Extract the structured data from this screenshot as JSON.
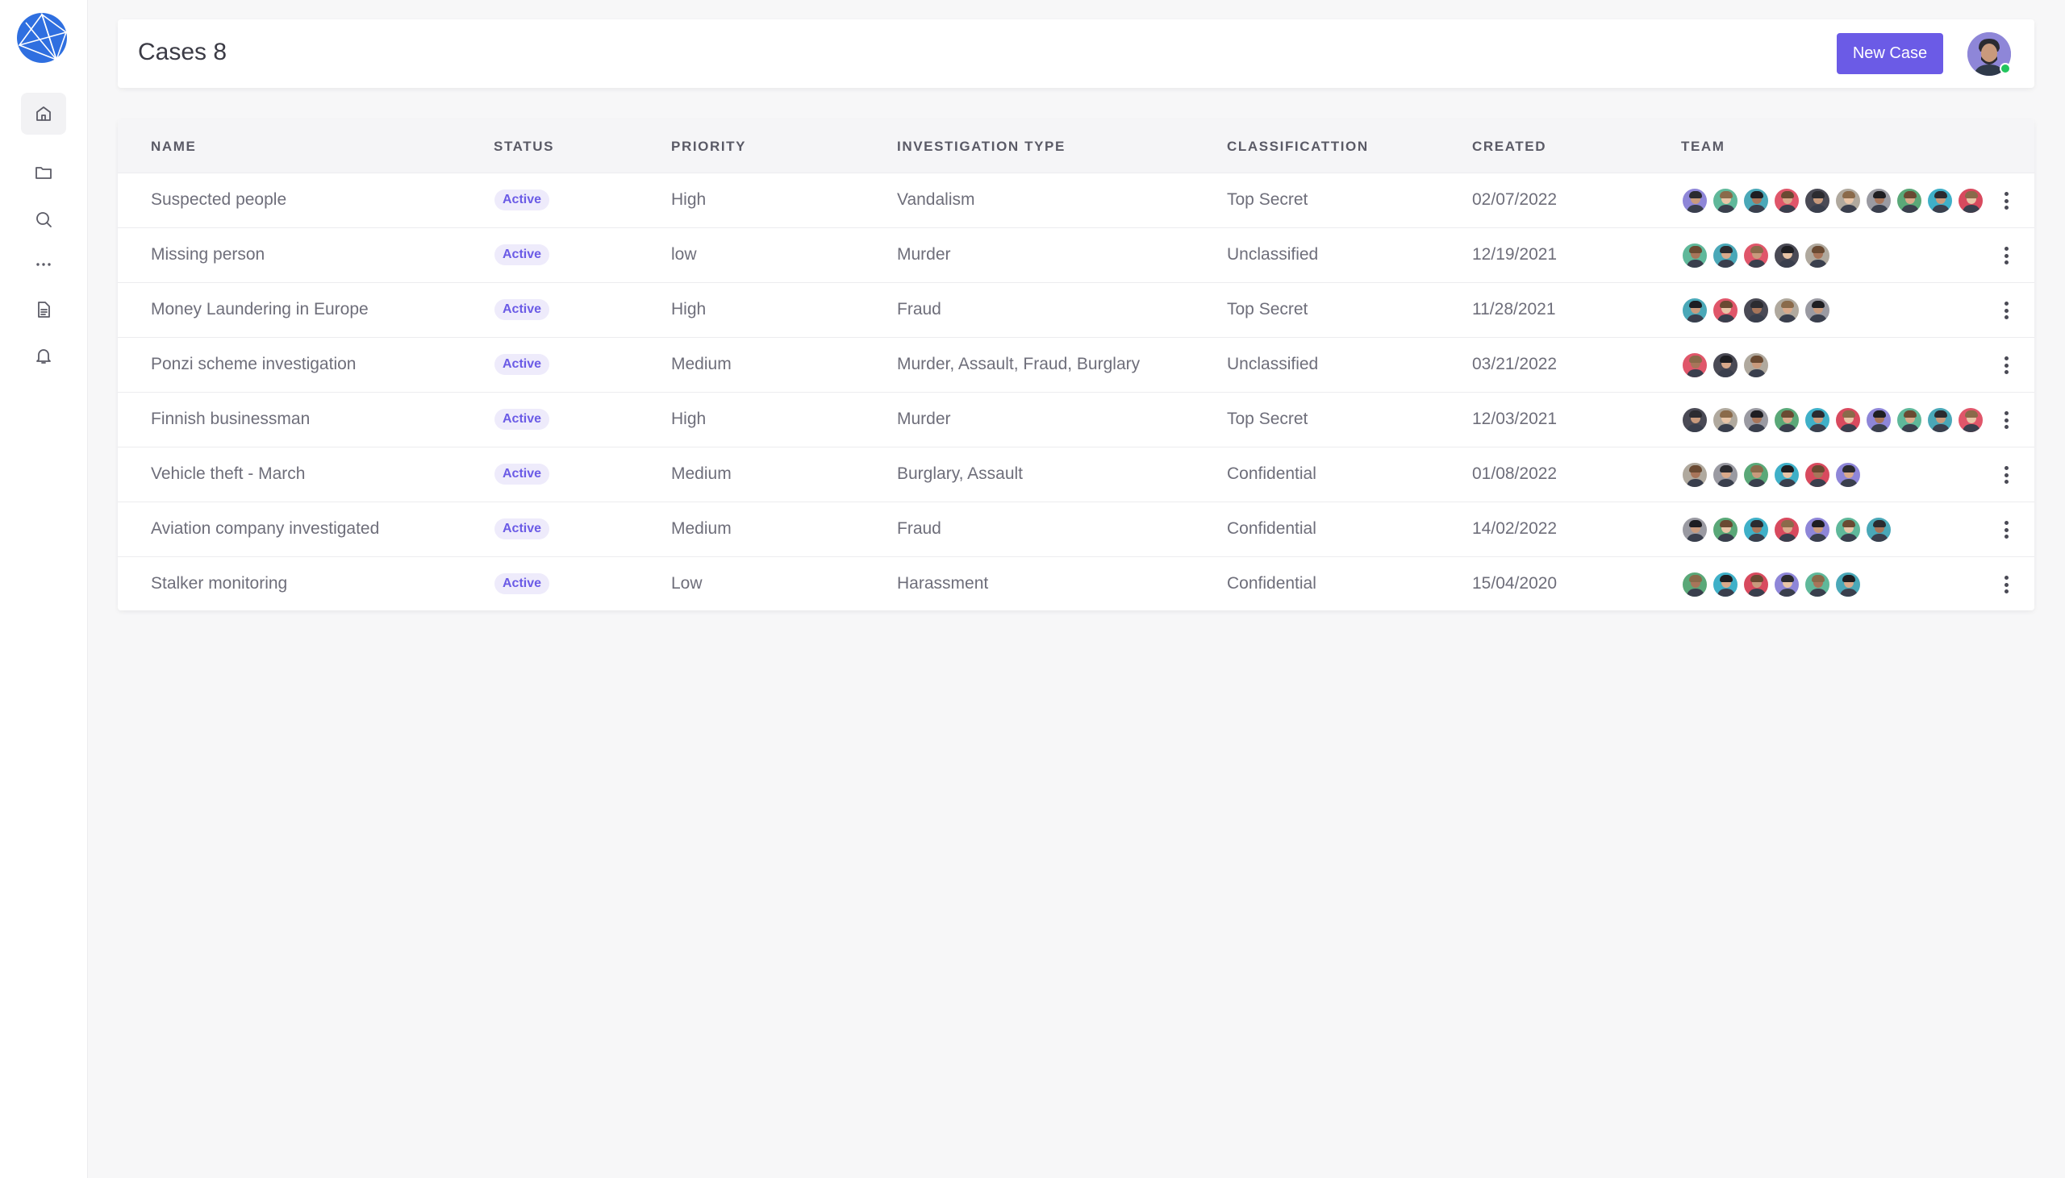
{
  "header": {
    "title": "Cases 8",
    "new_case_label": "New Case"
  },
  "sidebar": {
    "items": [
      {
        "name": "home",
        "icon": "home-icon",
        "active": true
      },
      {
        "name": "cases",
        "icon": "folder-icon",
        "active": false
      },
      {
        "name": "search",
        "icon": "search-icon",
        "active": false
      },
      {
        "name": "more",
        "icon": "more-horizontal-icon",
        "active": false
      },
      {
        "name": "documents",
        "icon": "document-icon",
        "active": false
      },
      {
        "name": "notifications",
        "icon": "bell-icon",
        "active": false
      }
    ]
  },
  "table": {
    "columns": [
      "NAME",
      "STATUS",
      "PRIORITY",
      "INVESTIGATION TYPE",
      "CLASSIFICATTION",
      "CREATED",
      "TEAM"
    ],
    "rows": [
      {
        "name": "Suspected people",
        "status": "Active",
        "priority": "High",
        "type": "Vandalism",
        "classification": "Top Secret",
        "created": "02/07/2022",
        "team": 10
      },
      {
        "name": "Missing person",
        "status": "Active",
        "priority": "low",
        "type": "Murder",
        "classification": "Unclassified",
        "created": "12/19/2021",
        "team": 5
      },
      {
        "name": "Money Laundering in Europe",
        "status": "Active",
        "priority": "High",
        "type": "Fraud",
        "classification": "Top Secret",
        "created": "11/28/2021",
        "team": 5
      },
      {
        "name": "Ponzi scheme investigation",
        "status": "Active",
        "priority": "Medium",
        "type": "Murder, Assault, Fraud, Burglary",
        "classification": "Unclassified",
        "created": "03/21/2022",
        "team": 3
      },
      {
        "name": "Finnish businessman",
        "status": "Active",
        "priority": "High",
        "type": "Murder",
        "classification": "Top Secret",
        "created": "12/03/2021",
        "team": 10
      },
      {
        "name": "Vehicle theft - March",
        "status": "Active",
        "priority": "Medium",
        "type": "Burglary, Assault",
        "classification": "Confidential",
        "created": "01/08/2022",
        "team": 6
      },
      {
        "name": "Aviation company investigated",
        "status": "Active",
        "priority": "Medium",
        "type": "Fraud",
        "classification": "Confidential",
        "created": "14/02/2022",
        "team": 7
      },
      {
        "name": "Stalker monitoring",
        "status": "Active",
        "priority": "Low",
        "type": "Harassment",
        "classification": "Confidential",
        "created": "15/04/2020",
        "team": 6
      }
    ]
  },
  "colors": {
    "accent": "#6b5be6",
    "badge_bg": "#eeebfb",
    "online": "#22c55e",
    "avatar_palette": [
      "#8e86d8",
      "#5fb89a",
      "#4aa8b8",
      "#e0566a",
      "#4a4a55",
      "#b0a99e",
      "#9a9aa2",
      "#5aa878",
      "#3fb0c8",
      "#d84a5e"
    ]
  }
}
